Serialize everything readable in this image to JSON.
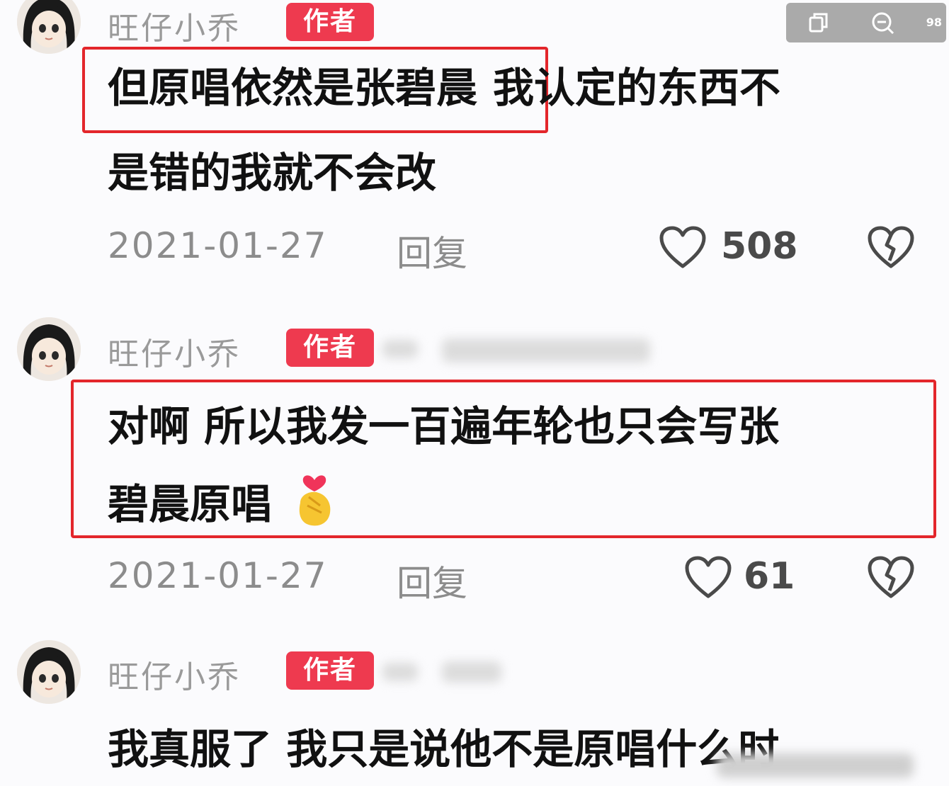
{
  "toolbar": {
    "icons": [
      "copy-icon",
      "zoom-out-icon"
    ],
    "partial_text": "98"
  },
  "colors": {
    "badge": "#ee3a4f",
    "highlight": "#e3262b",
    "muted": "#8c8c8c"
  },
  "comments": [
    {
      "username": "旺仔小乔",
      "badge": "作者",
      "text_highlighted": "但原唱依然是张碧晨",
      "text_line1_rest": "我认定的东西不",
      "text_line2": "是错的我就不会改",
      "date": "2021-01-27",
      "reply": "回复",
      "likes": "508"
    },
    {
      "username": "旺仔小乔",
      "badge": "作者",
      "text_line1": "对啊 所以我发一百遍年轮也只会写张",
      "text_line2": "碧晨原唱",
      "emoji": "finger-heart-emoji",
      "date": "2021-01-27",
      "reply": "回复",
      "likes": "61"
    },
    {
      "username": "旺仔小乔",
      "badge": "作者",
      "text_line1": "我真服了 我只是说他不是原唱什么时"
    }
  ]
}
